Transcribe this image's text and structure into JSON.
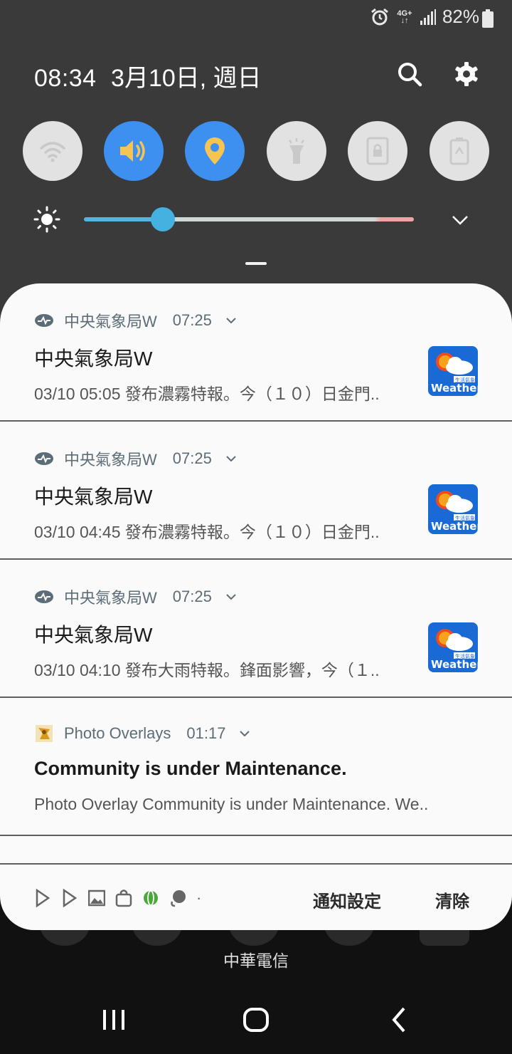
{
  "status_bar": {
    "network": "4G+",
    "battery": "82%"
  },
  "header": {
    "time": "08:34",
    "date": "3月10日, 週日"
  },
  "notifications": [
    {
      "app": "中央氣象局W",
      "time": "07:25",
      "title": "中央氣象局W",
      "text": "03/10 05:05 發布濃霧特報。今（１０）日金門..",
      "thumb_text": "Weather",
      "thumb_sub": "生活氣象"
    },
    {
      "app": "中央氣象局W",
      "time": "07:25",
      "title": "中央氣象局W",
      "text": "03/10 04:45 發布濃霧特報。今（１０）日金門..",
      "thumb_text": "Weather",
      "thumb_sub": "生活氣象"
    },
    {
      "app": "中央氣象局W",
      "time": "07:25",
      "title": "中央氣象局W",
      "text": "03/10 04:10 發布大雨特報。鋒面影響，今（１..",
      "thumb_text": "Weather",
      "thumb_sub": "生活氣象"
    },
    {
      "app": "Photo Overlays",
      "time": "01:17",
      "title": "Community is under Maintenance.",
      "text": "Photo Overlay Community is under Maintenance. We.."
    }
  ],
  "footer": {
    "settings_label": "通知設定",
    "clear_label": "清除",
    "more": "·"
  },
  "carrier": "中華電信",
  "brightness_level": 0.24,
  "colors": {
    "toggle_on": "#3d8ff0",
    "toggle_off": "#e2e2e2",
    "panel_bg": "#fafafa",
    "slider": "#45b1e0"
  }
}
